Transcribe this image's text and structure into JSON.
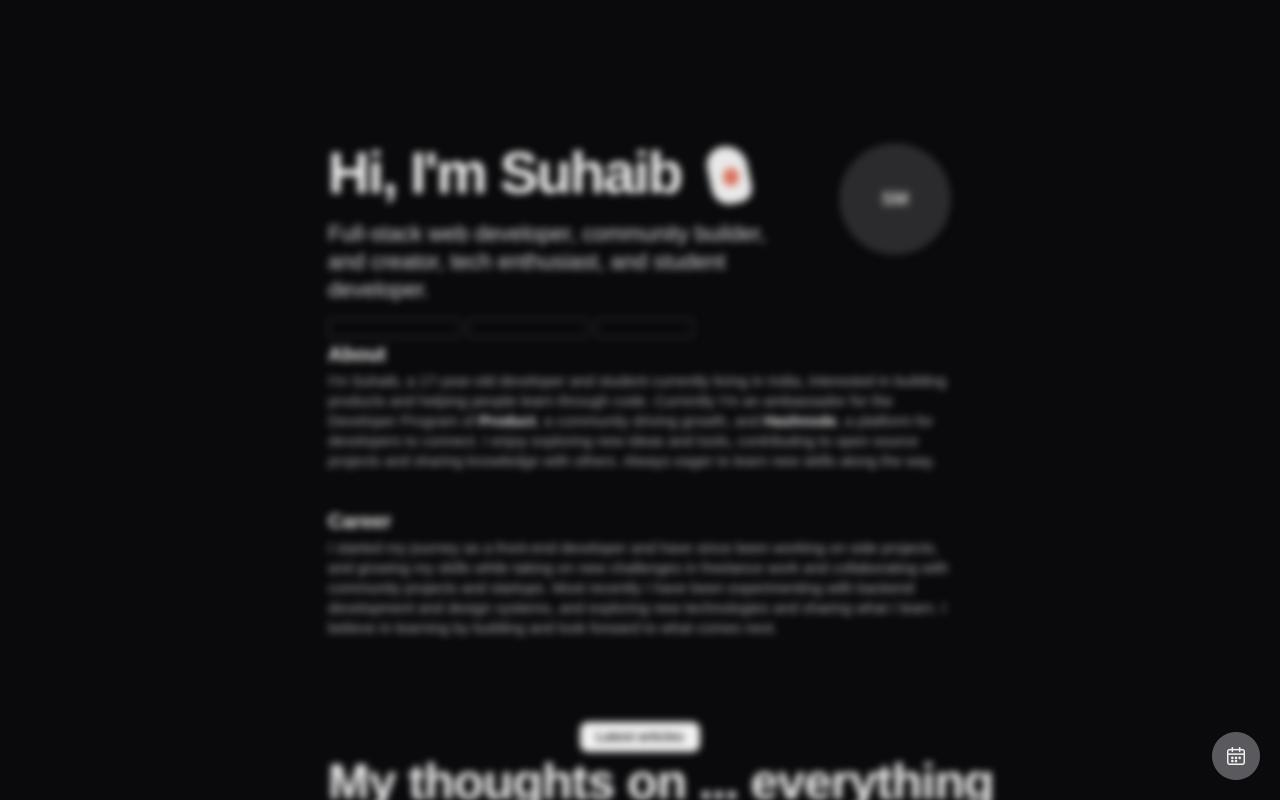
{
  "hero": {
    "title": "Hi, I'm Suhaib",
    "wave_icon": "waving-hand-icon",
    "subtitle": "Full-stack web developer, community builder, and creator, tech enthusiast, and student developer.",
    "chips": [
      "",
      "",
      ""
    ]
  },
  "avatar": {
    "initials": "SM"
  },
  "about": {
    "heading": "About",
    "body_before_1": "I'm Suhaib, a 17-year-old developer and student currently living in India, interested in building products and helping people learn through code. Currently I'm an ambassador for the Developer Program of ",
    "bold_1": "Product",
    "body_between": ", a community driving growth, and ",
    "bold_2": "Hashnode",
    "body_after": ", a platform for developers to connect. I enjoy exploring new ideas and tools, contributing to open source projects and sharing knowledge with others. Always eager to learn new skills along the way."
  },
  "career": {
    "heading": "Career",
    "body": "I started my journey as a front-end developer and have since been working on side projects, and growing my skills while taking on new challenges in freelance work and collaborating with community projects and startups. Most recently I have been experimenting with backend development and design systems, and exploring new technologies and sharing what I learn. I believe in learning by building and look forward to what comes next."
  },
  "blog": {
    "tag": "Latest articles",
    "title": "My thoughts on ... everything"
  },
  "floating": {
    "calendar_icon": "calendar-icon"
  },
  "colors": {
    "background": "#0a0a0c",
    "avatar_bg": "#2b2b2d",
    "floating_button": "#5a5a5e",
    "accent_palm": "#d9705a"
  }
}
